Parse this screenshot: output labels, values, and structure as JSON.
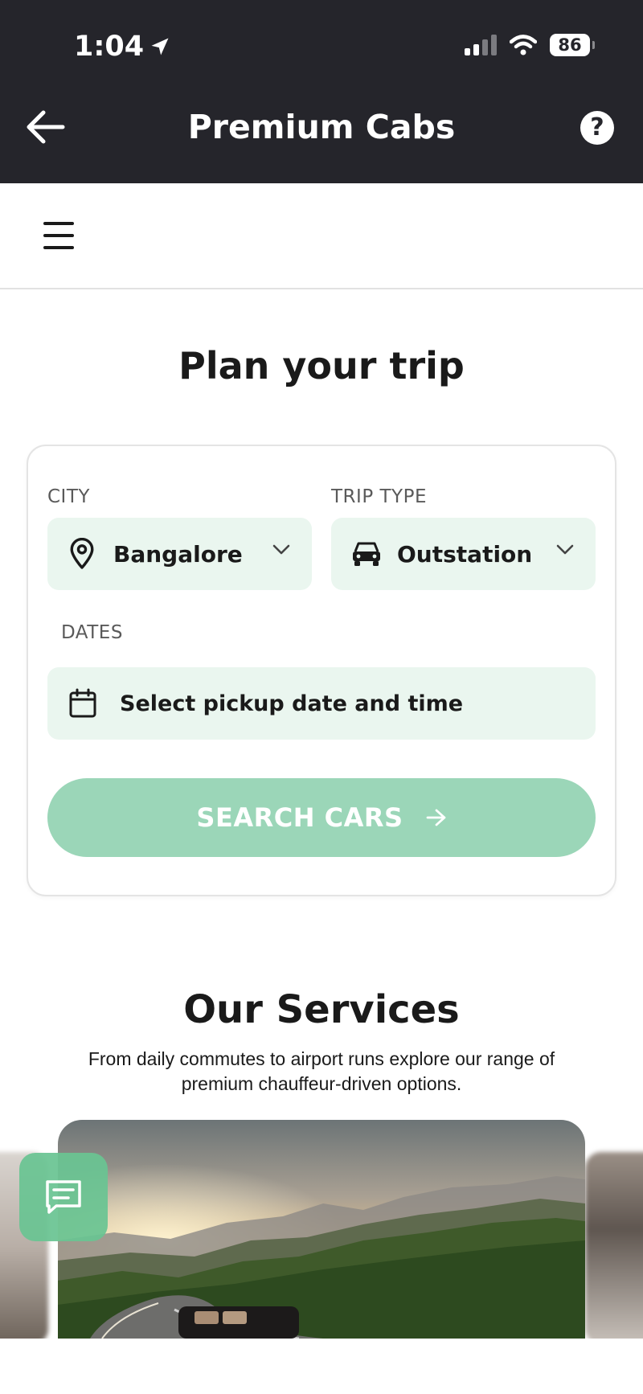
{
  "status_bar": {
    "time": "1:04",
    "battery": "86"
  },
  "header": {
    "title": "Premium Cabs",
    "help_label": "?"
  },
  "page": {
    "title": "Plan your trip"
  },
  "form": {
    "city_label": "CITY",
    "city_value": "Bangalore",
    "trip_type_label": "TRIP TYPE",
    "trip_type_value": "Outstation",
    "dates_label": "DATES",
    "dates_placeholder": "Select pickup date and time",
    "search_label": "SEARCH CARS"
  },
  "services": {
    "title": "Our Services",
    "subtitle": "From daily commutes to airport runs explore our range of premium chauffeur-driven options."
  },
  "colors": {
    "header_bg": "#25252b",
    "field_bg": "#eaf6ef",
    "search_button": "#9bd6b8",
    "chat_button": "#69c492"
  },
  "icons": {
    "back": "arrow-left-icon",
    "help": "help-circle-icon",
    "menu": "hamburger-menu-icon",
    "city": "map-pin-icon",
    "trip_type": "car-icon",
    "dates": "calendar-icon",
    "dropdown": "chevron-down-icon",
    "search": "arrow-right-icon",
    "chat": "chat-message-icon"
  }
}
